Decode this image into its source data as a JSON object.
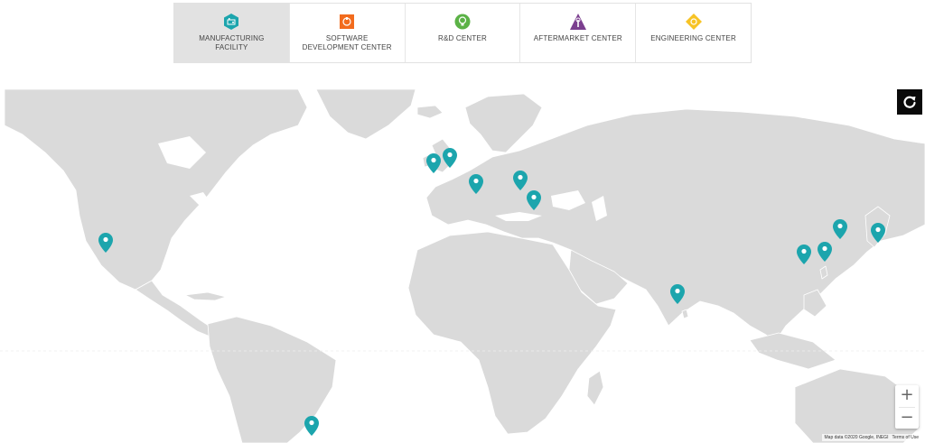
{
  "tabs": [
    {
      "label": "MANUFACTURING FACILITY",
      "icon": "factory-icon",
      "color": "#1ca5ad",
      "active": true
    },
    {
      "label": "SOFTWARE DEVELOPMENT CENTER",
      "icon": "code-icon",
      "color": "#f26b1d",
      "active": false
    },
    {
      "label": "R&D CENTER",
      "icon": "lightbulb-icon",
      "color": "#5bb246",
      "active": false
    },
    {
      "label": "AFTERMARKET CENTER",
      "icon": "wrench-icon",
      "color": "#7b3f8f",
      "active": false
    },
    {
      "label": "ENGINEERING CENTER",
      "icon": "gear-icon",
      "color": "#f7c325",
      "active": false
    }
  ],
  "map": {
    "land_color": "#dadada",
    "pin_color": "#1ca5ad",
    "attribution": "Map data ©2020 Google, INEGI",
    "terms_label": "Terms of Use",
    "zoom_in_label": "+",
    "zoom_out_label": "−"
  }
}
